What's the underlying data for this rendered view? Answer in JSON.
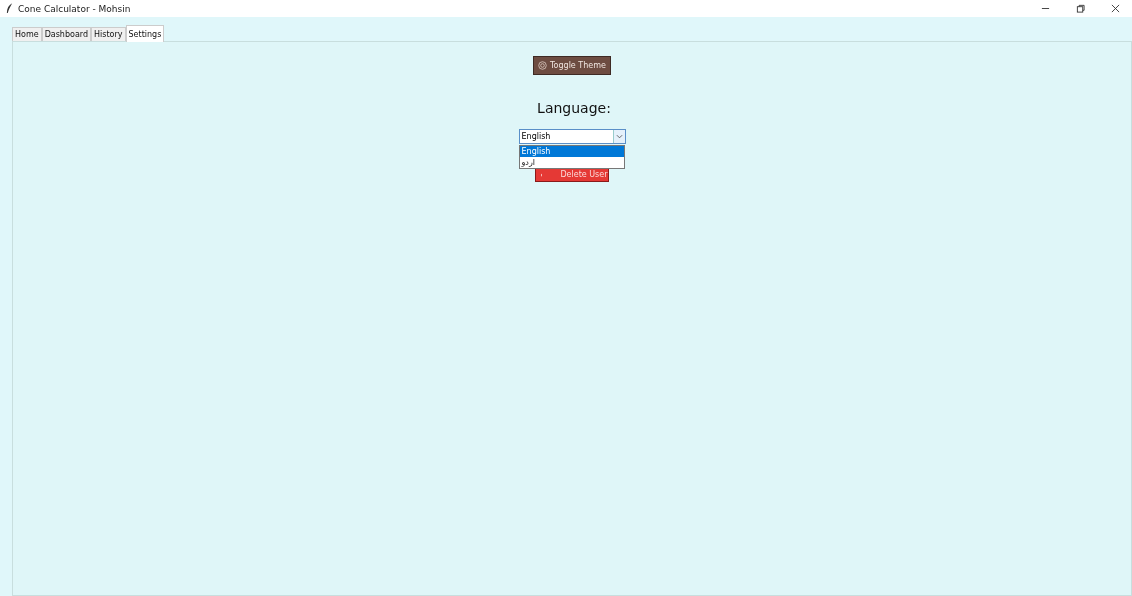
{
  "window": {
    "title": "Cone Calculator - Mohsin"
  },
  "tabs": [
    {
      "label": "Home",
      "selected": false
    },
    {
      "label": "Dashboard",
      "selected": false
    },
    {
      "label": "History",
      "selected": false
    },
    {
      "label": "Settings",
      "selected": true
    }
  ],
  "settings": {
    "toggle_theme": "Toggle Theme",
    "language_label": "Language:",
    "language": {
      "value": "English",
      "expanded": true,
      "options": [
        {
          "label": "English",
          "selected": true
        },
        {
          "label": "اردو",
          "selected": false
        }
      ]
    },
    "delete_user": "Delete User"
  }
}
